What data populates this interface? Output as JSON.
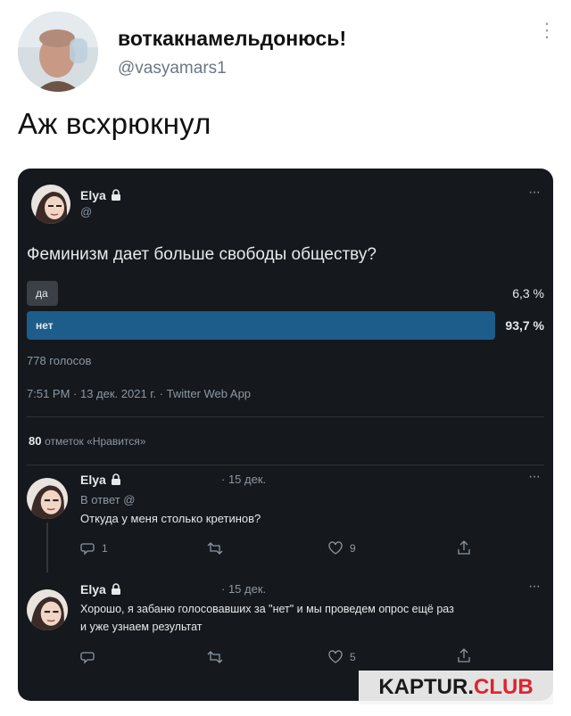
{
  "outer": {
    "name": "воткакнамельдонюсь!",
    "handle": "@vasyamars1",
    "text": "Аж всхрюкнул"
  },
  "card": {
    "author": "Elya",
    "handle": "@",
    "question": "Феминизм дает больше свободы обществу?",
    "options": [
      {
        "label": "да",
        "percent_label": "6,3 %",
        "percent": 6.3,
        "winner": false
      },
      {
        "label": "нет",
        "percent_label": "93,7 %",
        "percent": 93.7,
        "winner": true
      }
    ],
    "votes": "778 голосов",
    "timestamp": "7:51 PM · 13 дек. 2021 г. · Twitter Web App",
    "likes_count": "80",
    "likes_label": "отметок «Нравится»",
    "replies": [
      {
        "author": "Elya",
        "date": "· 15 дек.",
        "reply_to": "В ответ @",
        "text": "Откуда у меня столько кретинов?",
        "reply_count": "1",
        "retweet_count": "",
        "like_count": "9"
      },
      {
        "author": "Elya",
        "date": "· 15 дек.",
        "text1": "Хорошо, я забаню голосовавших за \"нет\" и мы проведем опрос ещё раз",
        "text2": "и уже узнаем результат",
        "reply_count": "",
        "retweet_count": "",
        "like_count": "5"
      }
    ]
  },
  "watermark": {
    "part1": "KAPTUR.",
    "part2": "CLUB"
  },
  "colors": {
    "card_bg": "#15181c",
    "winner_bar": "#1d5d8c",
    "loser_bar": "#3a4046",
    "link": "#1d9bf0",
    "watermark_accent": "#e0232d"
  }
}
